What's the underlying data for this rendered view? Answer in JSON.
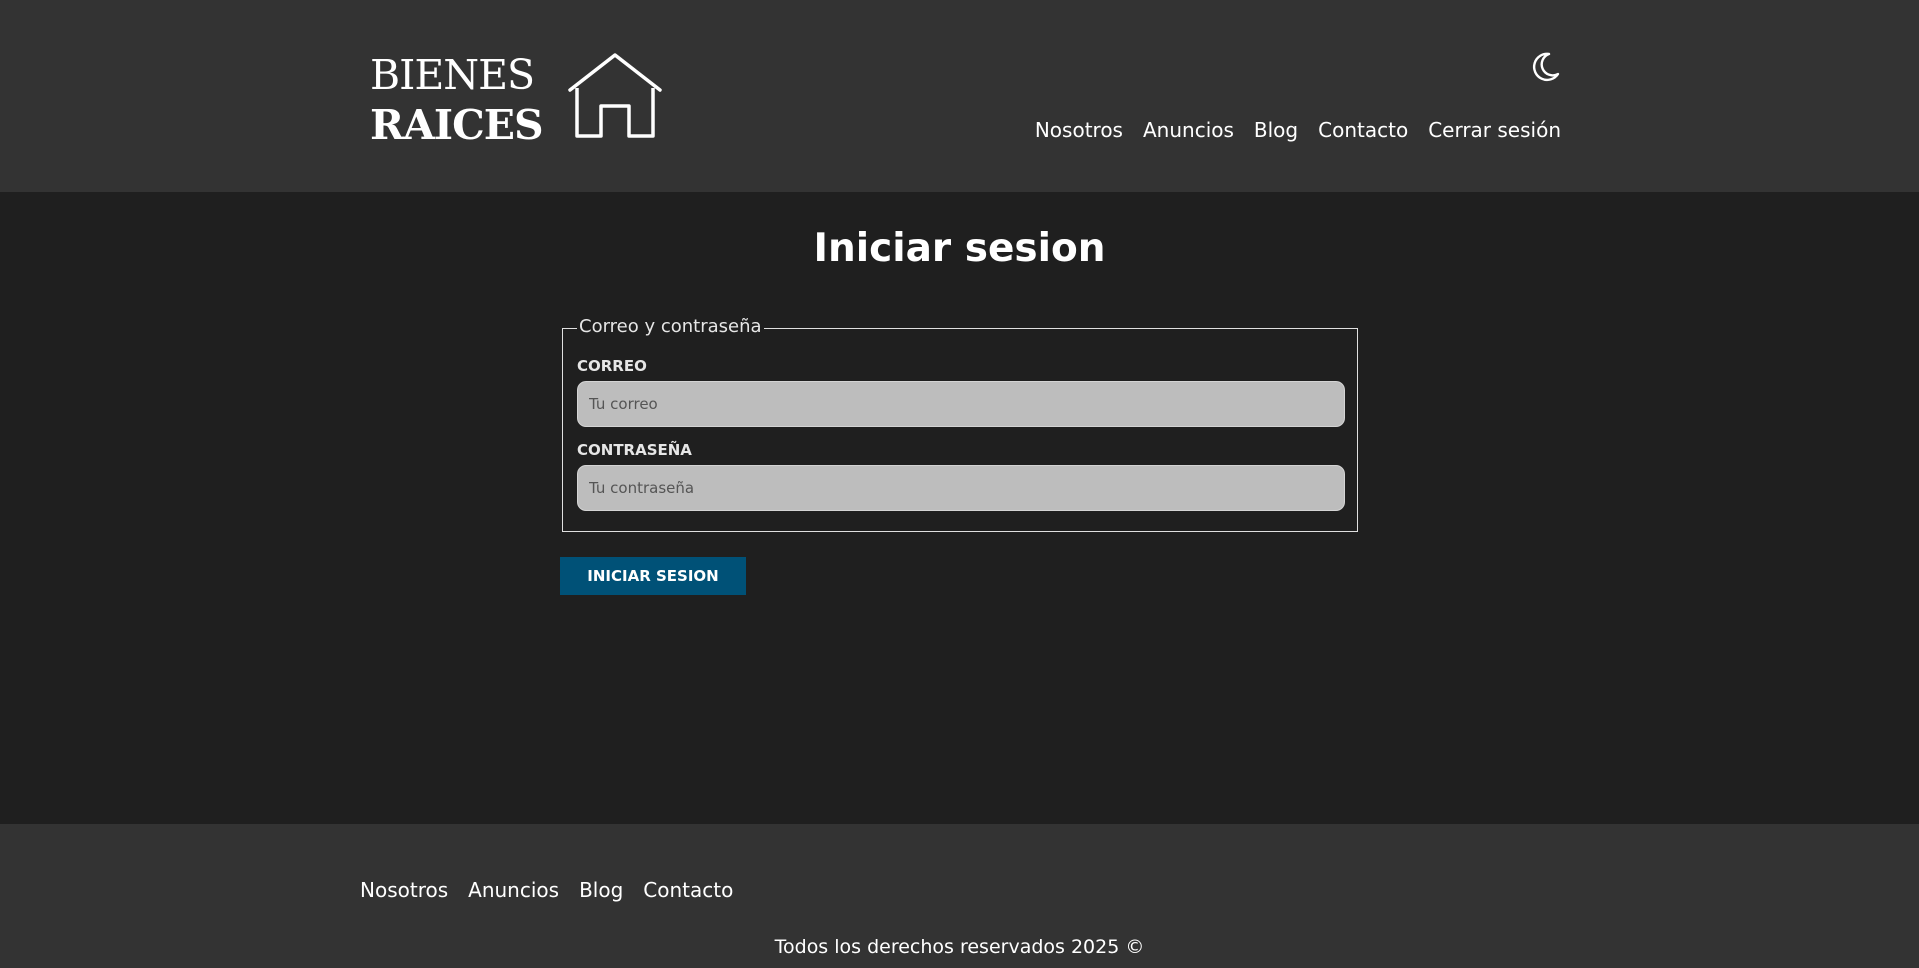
{
  "header": {
    "logo": {
      "line1": "BIENES",
      "line2": "RAICES"
    },
    "theme_icon": "moon-icon",
    "nav": [
      "Nosotros",
      "Anuncios",
      "Blog",
      "Contacto",
      "Cerrar sesión"
    ]
  },
  "main": {
    "title": "Iniciar sesion",
    "form": {
      "legend": "Correo y contraseña",
      "email": {
        "label": "CORREO",
        "placeholder": "Tu correo",
        "value": ""
      },
      "password": {
        "label": "CONTRASEÑA",
        "placeholder": "Tu contraseña",
        "value": ""
      },
      "submit_label": "INICIAR SESION"
    }
  },
  "footer": {
    "nav": [
      "Nosotros",
      "Anuncios",
      "Blog",
      "Contacto"
    ],
    "copyright": "Todos los derechos reservados 2025 ©"
  },
  "colors": {
    "header_bg": "#333333",
    "page_bg": "#1f1f1f",
    "button_bg": "#005177",
    "input_bg": "#bdbdbd"
  }
}
